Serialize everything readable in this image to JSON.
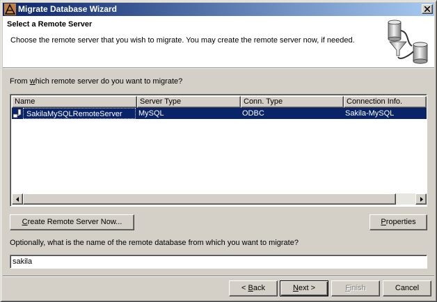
{
  "window": {
    "title": "Migrate Database Wizard"
  },
  "header": {
    "title": "Select a Remote Server",
    "description": "Choose the remote server that you wish to migrate. You may create the remote server now, if needed."
  },
  "server_question": "From which remote server do you want to migrate?",
  "servers_table": {
    "columns": [
      "Name",
      "Server Type",
      "Conn. Type",
      "Connection Info."
    ],
    "rows": [
      {
        "name": "SakilaMySQLRemoteServer",
        "server_type": "MySQL",
        "conn_type": "ODBC",
        "connection_info": "Sakila-MySQL",
        "selected": true
      }
    ]
  },
  "buttons": {
    "create_remote_server": "Create Remote Server Now...",
    "properties": "Properties",
    "back": "< Back",
    "next": "Next >",
    "finish": "Finish",
    "cancel": "Cancel"
  },
  "database_prompt": "Optionally, what is the name of the remote database from which you want to migrate?",
  "database_input": {
    "value": "sakila"
  },
  "colors": {
    "titlebar_start": "#0a246a",
    "titlebar_end": "#a6caf0",
    "selection": "#0a246a",
    "face": "#d4d0c8"
  },
  "icons": {
    "app": "wizard-app-icon",
    "close": "close-icon",
    "header": "database-funnel-icon",
    "row": "server-icon"
  }
}
